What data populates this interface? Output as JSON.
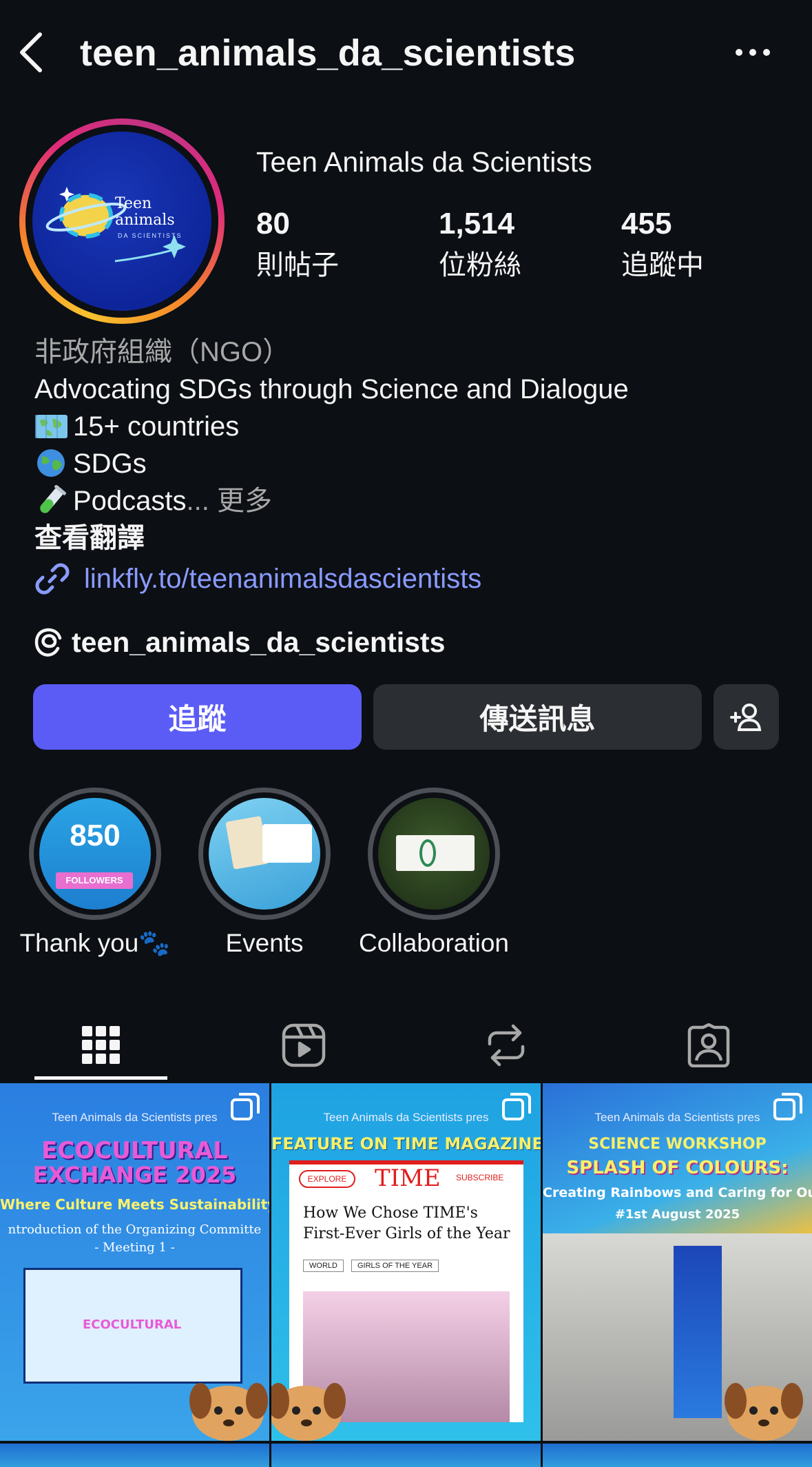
{
  "header": {
    "username": "teen_animals_da_scientists"
  },
  "profile": {
    "display_name": "Teen Animals da Scientists",
    "avatar_text_line1": "Teen",
    "avatar_text_line2": "animals",
    "avatar_text_line3": "DA SCIENTISTS",
    "stats": [
      {
        "value": "80",
        "label": "則帖子"
      },
      {
        "value": "1,514",
        "label": "位粉絲"
      },
      {
        "value": "455",
        "label": "追蹤中"
      }
    ]
  },
  "bio": {
    "category": "非政府組織（NGO）",
    "line1": "Advocating SDGs through Science and Dialogue",
    "line2": "15+ countries",
    "line3": "SDGs",
    "line4": "Podcasts",
    "ellipsis": "...",
    "more": "更多",
    "translate": "查看翻譯",
    "link": "linkfly.to/teenanimalsdascientists",
    "threads": "teen_animals_da_scientists"
  },
  "actions": {
    "follow": "追蹤",
    "message": "傳送訊息"
  },
  "highlights": [
    {
      "label": "Thank you🐾",
      "big": "850",
      "badge": "FOLLOWERS"
    },
    {
      "label": "Events"
    },
    {
      "label": "Collaboration"
    }
  ],
  "posts": [
    {
      "header": "Teen Animals da Scientists pres",
      "title1": "ECOCULTURAL",
      "title2": "EXCHANGE 2025",
      "subtitle": "Where Culture Meets Sustainability",
      "line": "ntroduction of the Organizing Committe",
      "line2": "- Meeting 1 -"
    },
    {
      "header": "Teen Animals da Scientists pres",
      "title1": "FEATURE ON TIME MAGAZINE",
      "explore": "EXPLORE",
      "brand": "TIME",
      "subscribe": "SUBSCRIBE",
      "headline1": "How We Chose TIME's",
      "headline2": "First-Ever Girls of the Year",
      "tag1": "WORLD",
      "tag2": "GIRLS OF THE YEAR"
    },
    {
      "header": "Teen Animals da Scientists pres",
      "title1": "SCIENCE WORKSHOP",
      "title2": "SPLASH OF COLOURS:",
      "subtitle": "Creating Rainbows and Caring for Our Pla",
      "date": "#1st August 2025"
    }
  ],
  "colors": {
    "accent": "#5b5cf6",
    "link": "#8a9bff",
    "background": "#0c0f14"
  }
}
